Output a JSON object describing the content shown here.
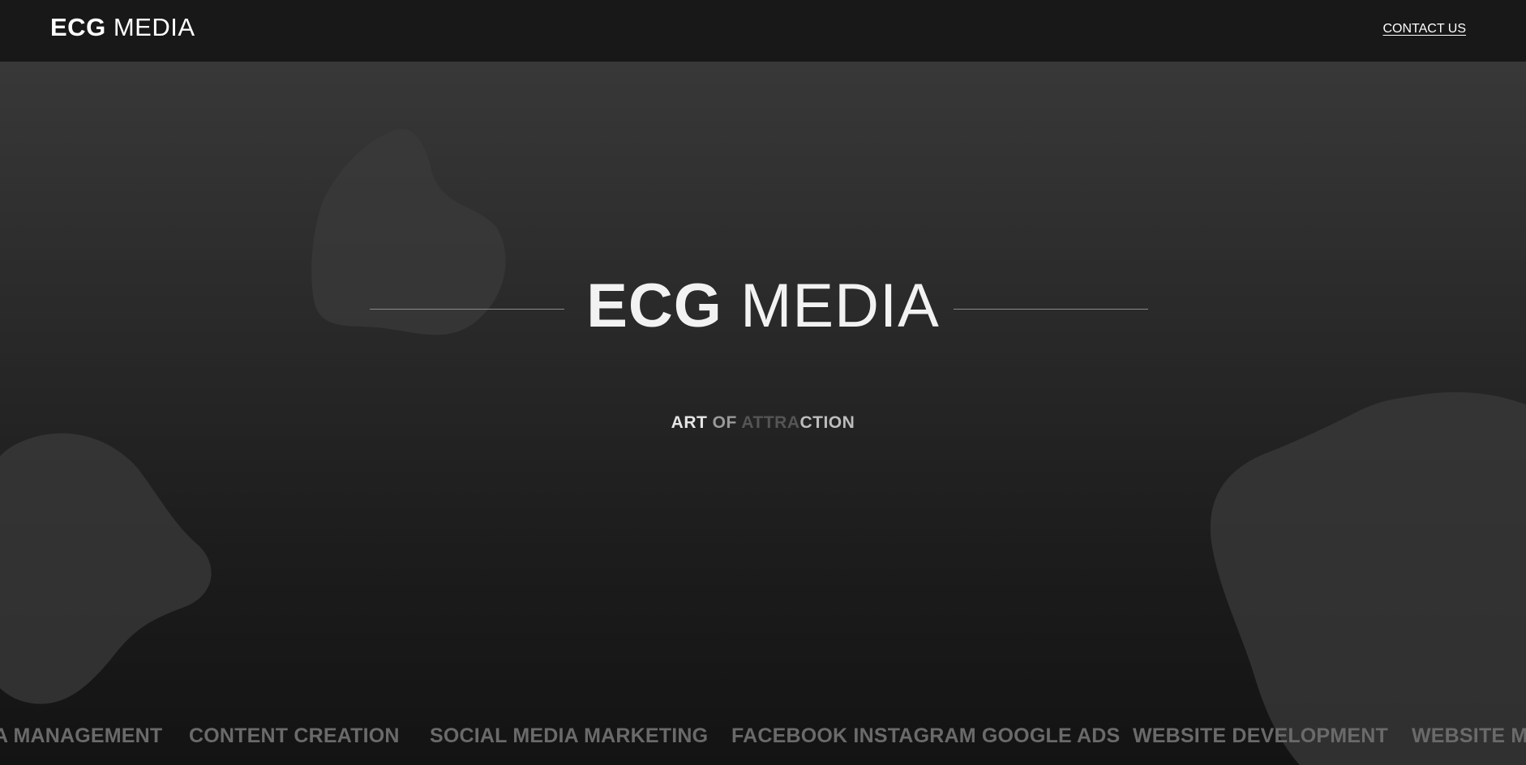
{
  "header": {
    "brand_bold": "ECG",
    "brand_light": "MEDIA",
    "contact_label": "CONTACT US"
  },
  "hero": {
    "title_bold": "ECG",
    "title_light": "MEDIA",
    "tagline_parts": [
      "ART ",
      "OF ",
      "ATTRA",
      "CTION"
    ]
  },
  "ticker": {
    "items": [
      "A MANAGEMENT",
      "CONTENT CREATION",
      "SOCIAL MEDIA MARKETING",
      "FACEBOOK INSTAGRAM GOOGLE ADS",
      "WEBSITE DEVELOPMENT",
      "WEBSITE MA"
    ]
  },
  "colors": {
    "header_bg": "#181818",
    "hero_top": "#383838",
    "hero_bottom": "#131313",
    "text_primary": "#f2f2f2",
    "ticker_text": "#6a6a6a"
  }
}
